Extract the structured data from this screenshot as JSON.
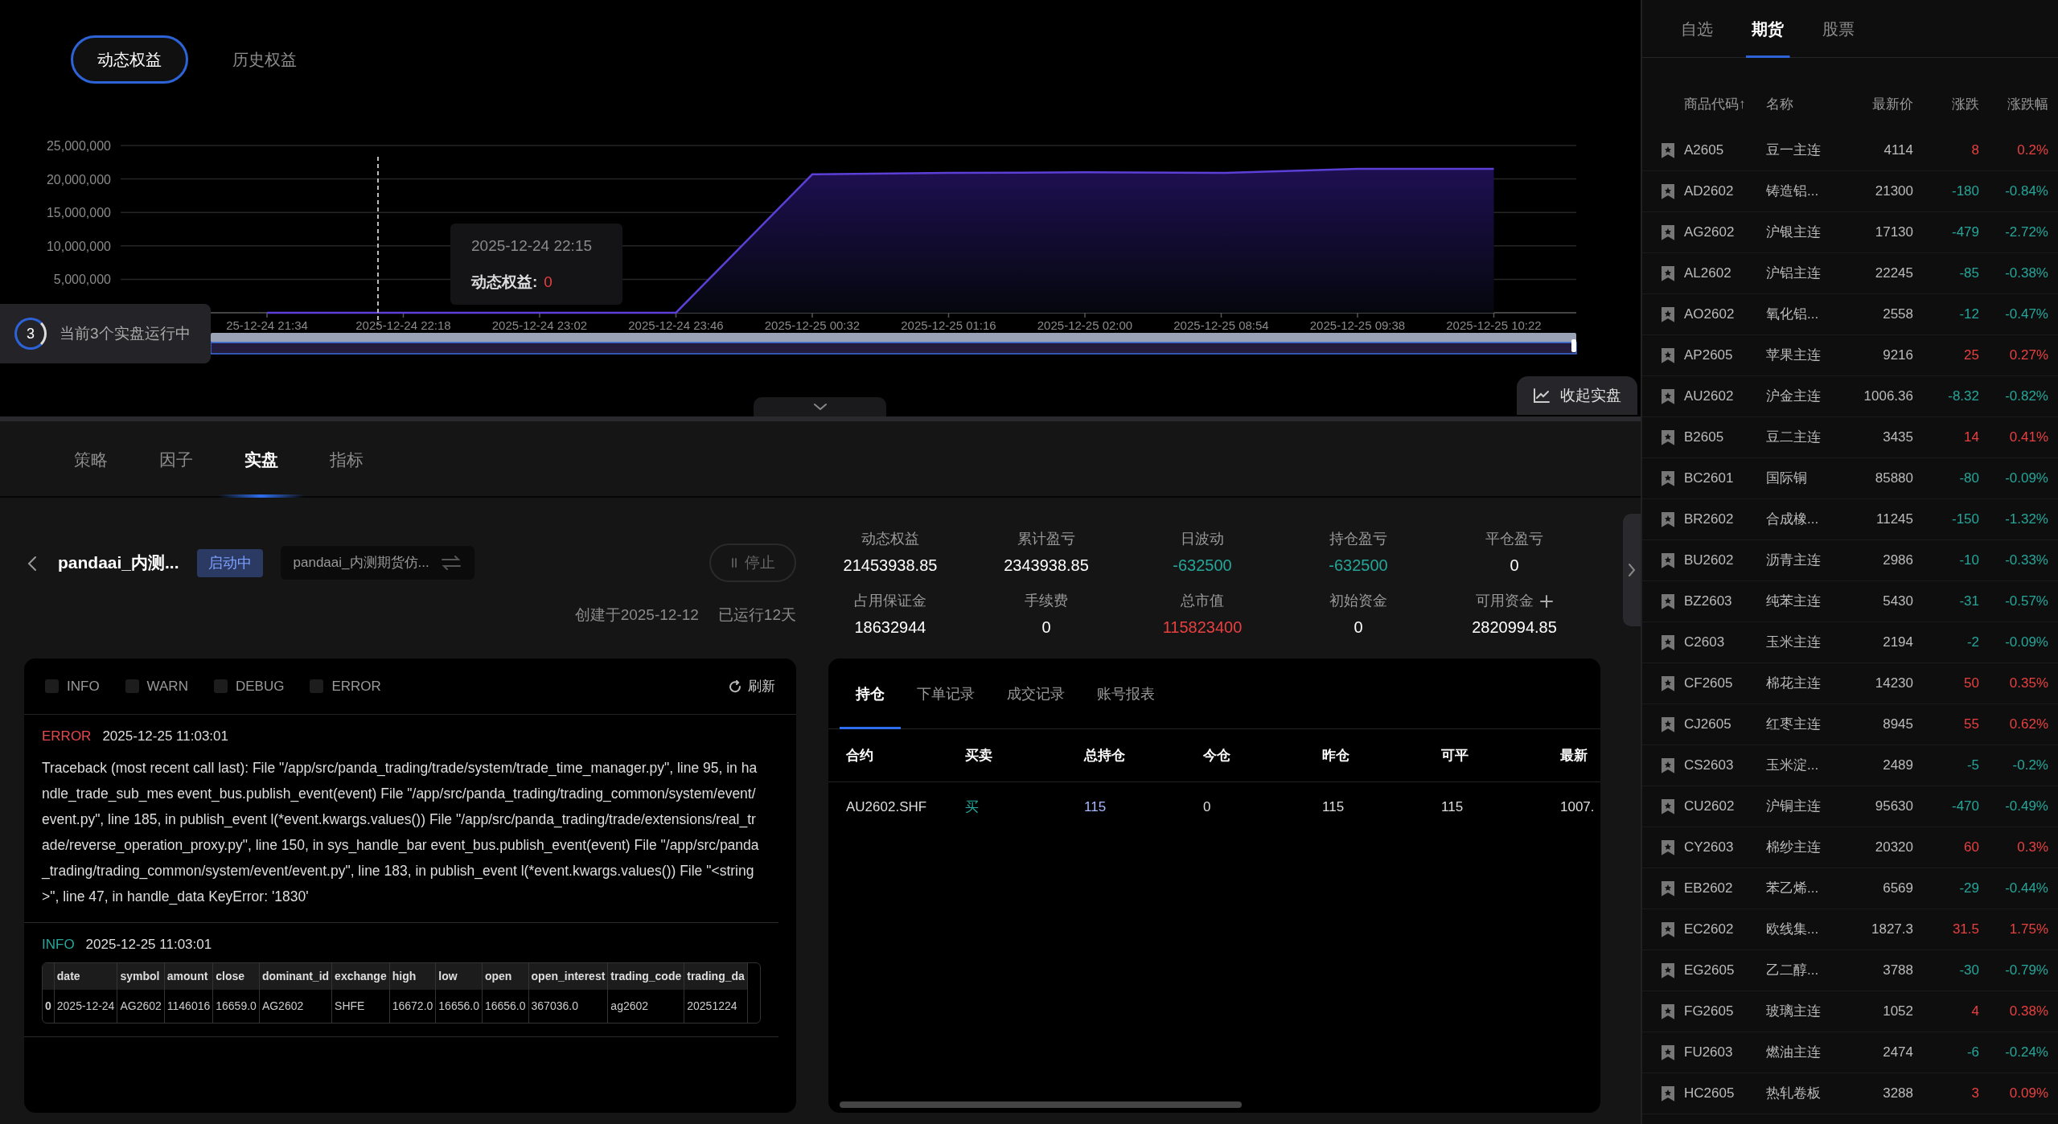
{
  "chart_panel": {
    "toggles": [
      {
        "label": "动态权益",
        "selected": true
      },
      {
        "label": "历史权益",
        "selected": false
      }
    ],
    "chart_data": {
      "type": "area",
      "x": [
        "25-12-24 21:34",
        "2025-12-24 22:18",
        "2025-12-24 23:02",
        "2025-12-24 23:46",
        "2025-12-25 00:32",
        "2025-12-25 01:16",
        "2025-12-25 02:00",
        "2025-12-25 08:54",
        "2025-12-25 09:38",
        "2025-12-25 10:22"
      ],
      "series": [
        {
          "name": "动态权益",
          "color": "#5b3fd6",
          "values": [
            0,
            0,
            0,
            0,
            20700000,
            20900000,
            21000000,
            20900000,
            21500000,
            21500000
          ]
        }
      ],
      "ylim": [
        0,
        25000000
      ],
      "grid": true,
      "yticks": [
        {
          "value": 5000000,
          "label": "5,000,000"
        },
        {
          "value": 10000000,
          "label": "10,000,000"
        },
        {
          "value": 15000000,
          "label": "15,000,000"
        },
        {
          "value": 20000000,
          "label": "20,000,000"
        },
        {
          "value": 25000000,
          "label": "25,000,000"
        }
      ]
    },
    "tooltip": {
      "time": "2025-12-24 22:15",
      "separator": ":",
      "value": "0"
    },
    "running_badge": {
      "count": "3",
      "text": "当前3个实盘运行中"
    },
    "collapse_button": "收起实盘"
  },
  "tabs": [
    {
      "label": "策略",
      "selected": false
    },
    {
      "label": "因子",
      "selected": false
    },
    {
      "label": "实盘",
      "selected": true
    },
    {
      "label": "指标",
      "selected": false
    }
  ],
  "strategy": {
    "name": "pandaai_内测...",
    "status": "启动中",
    "account": "pandaai_内测期货仿...",
    "stop_button": "停止",
    "created": "创建于2025-12-12",
    "running": "已运行12天"
  },
  "stats": [
    {
      "label": "动态权益",
      "value": "21453938.85",
      "color": "#ffffff",
      "kind": "plain"
    },
    {
      "label": "累计盈亏",
      "value": "2343938.85",
      "color": "#ffffff",
      "kind": "plain"
    },
    {
      "label": "日波动",
      "value": "-632500",
      "color": "#26a69a",
      "kind": "plain"
    },
    {
      "label": "持仓盈亏",
      "value": "-632500",
      "color": "#26a69a",
      "kind": "plain"
    },
    {
      "label": "平仓盈亏",
      "value": "0",
      "color": "#ffffff",
      "kind": "plain"
    },
    {
      "label": "占用保证金",
      "value": "18632944",
      "color": "#ffffff",
      "kind": "plain"
    },
    {
      "label": "手续费",
      "value": "0",
      "color": "#ffffff",
      "kind": "plain"
    },
    {
      "label": "总市值",
      "value": "115823400",
      "color": "#e84040",
      "kind": "plain"
    },
    {
      "label": "初始资金",
      "value": "0",
      "color": "#ffffff",
      "kind": "plain"
    },
    {
      "label": "可用资金",
      "value": "2820994.85",
      "color": "#ffffff",
      "kind": "addable"
    }
  ],
  "logs": {
    "filters": [
      {
        "label": "INFO",
        "checked": false
      },
      {
        "label": "WARN",
        "checked": false
      },
      {
        "label": "DEBUG",
        "checked": false
      },
      {
        "label": "ERROR",
        "checked": false
      }
    ],
    "refresh": "刷新",
    "entries": [
      {
        "kind": "text",
        "level": "ERROR",
        "time": "2025-12-25 11:03:01",
        "message": "Traceback (most recent call last): File \"/app/src/panda_trading/trade/system/trade_time_manager.py\", line 95, in handle_trade_sub_mes event_bus.publish_event(event) File \"/app/src/panda_trading/trading_common/system/event/event.py\", line 185, in publish_event l(*event.kwargs.values()) File \"/app/src/panda_trading/trade/extensions/real_trade/reverse_operation_proxy.py\", line 150, in sys_handle_bar event_bus.publish_event(event) File \"/app/src/panda_trading/trading_common/system/event/event.py\", line 183, in publish_event l(*event.kwargs.values()) File \"<string>\", line 47, in handle_data KeyError: '1830'"
      },
      {
        "kind": "table",
        "level": "INFO",
        "time": "2025-12-25 11:03:01",
        "columns": [
          "",
          "date",
          "symbol",
          "amount",
          "close",
          "dominant_id",
          "exchange",
          "high",
          "low",
          "open",
          "open_interest",
          "trading_code",
          "trading_da"
        ],
        "rows": [
          [
            "0",
            "2025-12-24",
            "AG2602",
            "1146016",
            "16659.0",
            "AG2602",
            "SHFE",
            "16672.0",
            "16656.0",
            "16656.0",
            "367036.0",
            "ag2602",
            "20251224"
          ]
        ]
      }
    ]
  },
  "positions": {
    "tabs": [
      {
        "label": "持仓",
        "selected": true
      },
      {
        "label": "下单记录",
        "selected": false
      },
      {
        "label": "成交记录",
        "selected": false
      },
      {
        "label": "账号报表",
        "selected": false
      }
    ],
    "columns": [
      "合约",
      "买卖",
      "总持仓",
      "今仓",
      "昨仓",
      "可平",
      "最新"
    ],
    "rows": [
      {
        "cells": [
          {
            "text": "AU2602.SHF"
          },
          {
            "text": "买",
            "color": "#26a69a"
          },
          {
            "text": "115",
            "color": "#a9b8ff"
          },
          {
            "text": "0"
          },
          {
            "text": "115"
          },
          {
            "text": "115"
          },
          {
            "text": "1007."
          }
        ]
      }
    ]
  },
  "market": {
    "tabs": [
      {
        "label": "自选",
        "selected": false
      },
      {
        "label": "期货",
        "selected": true
      },
      {
        "label": "股票",
        "selected": false
      }
    ],
    "columns": [
      "商品代码↑",
      "名称",
      "最新价",
      "涨跌",
      "涨跌幅"
    ],
    "rows": [
      {
        "code": "A2605",
        "name": "豆一主连",
        "price": "4114",
        "change": "8",
        "pct": "0.2%",
        "color": "#e84040"
      },
      {
        "code": "AD2602",
        "name": "铸造铝...",
        "price": "21300",
        "change": "-180",
        "pct": "-0.84%",
        "color": "#26a69a"
      },
      {
        "code": "AG2602",
        "name": "沪银主连",
        "price": "17130",
        "change": "-479",
        "pct": "-2.72%",
        "color": "#26a69a"
      },
      {
        "code": "AL2602",
        "name": "沪铝主连",
        "price": "22245",
        "change": "-85",
        "pct": "-0.38%",
        "color": "#26a69a"
      },
      {
        "code": "AO2602",
        "name": "氧化铝...",
        "price": "2558",
        "change": "-12",
        "pct": "-0.47%",
        "color": "#26a69a"
      },
      {
        "code": "AP2605",
        "name": "苹果主连",
        "price": "9216",
        "change": "25",
        "pct": "0.27%",
        "color": "#e84040"
      },
      {
        "code": "AU2602",
        "name": "沪金主连",
        "price": "1006.36",
        "change": "-8.32",
        "pct": "-0.82%",
        "color": "#26a69a"
      },
      {
        "code": "B2605",
        "name": "豆二主连",
        "price": "3435",
        "change": "14",
        "pct": "0.41%",
        "color": "#e84040"
      },
      {
        "code": "BC2601",
        "name": "国际铜",
        "price": "85880",
        "change": "-80",
        "pct": "-0.09%",
        "color": "#26a69a"
      },
      {
        "code": "BR2602",
        "name": "合成橡...",
        "price": "11245",
        "change": "-150",
        "pct": "-1.32%",
        "color": "#26a69a"
      },
      {
        "code": "BU2602",
        "name": "沥青主连",
        "price": "2986",
        "change": "-10",
        "pct": "-0.33%",
        "color": "#26a69a"
      },
      {
        "code": "BZ2603",
        "name": "纯苯主连",
        "price": "5430",
        "change": "-31",
        "pct": "-0.57%",
        "color": "#26a69a"
      },
      {
        "code": "C2603",
        "name": "玉米主连",
        "price": "2194",
        "change": "-2",
        "pct": "-0.09%",
        "color": "#26a69a"
      },
      {
        "code": "CF2605",
        "name": "棉花主连",
        "price": "14230",
        "change": "50",
        "pct": "0.35%",
        "color": "#e84040"
      },
      {
        "code": "CJ2605",
        "name": "红枣主连",
        "price": "8945",
        "change": "55",
        "pct": "0.62%",
        "color": "#e84040"
      },
      {
        "code": "CS2603",
        "name": "玉米淀...",
        "price": "2489",
        "change": "-5",
        "pct": "-0.2%",
        "color": "#26a69a"
      },
      {
        "code": "CU2602",
        "name": "沪铜主连",
        "price": "95630",
        "change": "-470",
        "pct": "-0.49%",
        "color": "#26a69a"
      },
      {
        "code": "CY2603",
        "name": "棉纱主连",
        "price": "20320",
        "change": "60",
        "pct": "0.3%",
        "color": "#e84040"
      },
      {
        "code": "EB2602",
        "name": "苯乙烯...",
        "price": "6569",
        "change": "-29",
        "pct": "-0.44%",
        "color": "#26a69a"
      },
      {
        "code": "EC2602",
        "name": "欧线集...",
        "price": "1827.3",
        "change": "31.5",
        "pct": "1.75%",
        "color": "#e84040"
      },
      {
        "code": "EG2605",
        "name": "乙二醇...",
        "price": "3788",
        "change": "-30",
        "pct": "-0.79%",
        "color": "#26a69a"
      },
      {
        "code": "FG2605",
        "name": "玻璃主连",
        "price": "1052",
        "change": "4",
        "pct": "0.38%",
        "color": "#e84040"
      },
      {
        "code": "FU2603",
        "name": "燃油主连",
        "price": "2474",
        "change": "-6",
        "pct": "-0.24%",
        "color": "#26a69a"
      },
      {
        "code": "HC2605",
        "name": "热轧卷板",
        "price": "3288",
        "change": "3",
        "pct": "0.09%",
        "color": "#e84040"
      }
    ]
  }
}
